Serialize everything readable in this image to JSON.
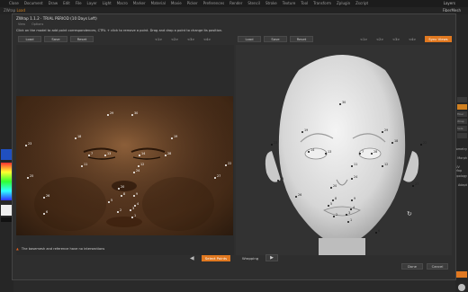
{
  "background": {
    "menu_items": [
      "Close",
      "Document",
      "Draw",
      "Edit",
      "File",
      "Layer",
      "Light",
      "Macro",
      "Marker",
      "Material",
      "Movie",
      "Picker",
      "Preferences",
      "Render",
      "Stencil",
      "Stroke",
      "Texture",
      "Tool",
      "Transform",
      "Zplugin",
      "Zscript"
    ],
    "menu_right": "Layers",
    "row2_left": "ZWrap",
    "row2_accent": "Load",
    "row2_right": "FiberMesh",
    "right_tabs": [
      "",
      "",
      "Fiber",
      "Wrap",
      "Sele",
      ""
    ],
    "right_labels": [
      "Geometry",
      "Morph",
      "UV Map",
      "Topology",
      "Adapt"
    ]
  },
  "dialog": {
    "title": "ZWrap 1.1.2 · TRIAL PERIOD (10 Days Left)",
    "menu": [
      "View",
      "Options"
    ],
    "instructions": "Click on the model to add point correspondences, CTRL + click to remove a point. Drag and drop a point to change its position.",
    "left_toolbar": {
      "load": "Load",
      "save": "Save",
      "reset": "Reset"
    },
    "right_toolbar": {
      "load": "Load",
      "save": "Save",
      "reset": "Reset"
    },
    "nav_labels": [
      "<1>",
      "<2>",
      "<3>",
      "<4>"
    ],
    "sync_views": "Sync Views",
    "warning": "The basemesh and reference have no intersections",
    "steps": {
      "select_points": "Select Points",
      "wrapping": "Wrapping"
    },
    "done": "Done",
    "cancel": "Cancel",
    "colors": {
      "accent": "#e07820",
      "panel": "#2e2e2e",
      "warning": "#e06020"
    }
  },
  "left_points": [
    {
      "id": "30",
      "label": "30"
    },
    {
      "id": "29",
      "label": "29"
    },
    {
      "id": "19",
      "label": "19"
    },
    {
      "id": "18",
      "label": "18"
    },
    {
      "id": "23",
      "label": "23"
    },
    {
      "id": "7",
      "label": "7"
    },
    {
      "id": "13",
      "label": "13"
    },
    {
      "id": "14",
      "label": "14"
    },
    {
      "id": "28",
      "label": "28"
    },
    {
      "id": "11",
      "label": "11"
    },
    {
      "id": "12",
      "label": "12"
    },
    {
      "id": "22",
      "label": "22"
    },
    {
      "id": "25",
      "label": "25"
    },
    {
      "id": "26",
      "label": "26"
    },
    {
      "id": "24",
      "label": "24"
    },
    {
      "id": "27",
      "label": "27"
    },
    {
      "id": "20",
      "label": "20"
    },
    {
      "id": "8",
      "label": "8"
    },
    {
      "id": "9",
      "label": "9"
    },
    {
      "id": "5",
      "label": "5"
    },
    {
      "id": "4",
      "label": "4"
    },
    {
      "id": "3",
      "label": "3"
    },
    {
      "id": "2",
      "label": "2"
    },
    {
      "id": "1",
      "label": "1"
    },
    {
      "id": "6",
      "label": "6"
    }
  ],
  "right_points": [
    {
      "id": "30",
      "label": "30"
    },
    {
      "id": "19",
      "label": "19"
    },
    {
      "id": "29",
      "label": "29"
    },
    {
      "id": "18",
      "label": "18"
    },
    {
      "id": "23",
      "label": "23"
    },
    {
      "id": "14",
      "label": "14"
    },
    {
      "id": "13",
      "label": "13"
    },
    {
      "id": "7",
      "label": "7"
    },
    {
      "id": "28",
      "label": "28"
    },
    {
      "id": "11",
      "label": "11"
    },
    {
      "id": "12",
      "label": "12"
    },
    {
      "id": "22",
      "label": "22"
    },
    {
      "id": "25",
      "label": "25"
    },
    {
      "id": "26",
      "label": "26"
    },
    {
      "id": "24",
      "label": "24"
    },
    {
      "id": "27",
      "label": "27"
    },
    {
      "id": "20",
      "label": "20"
    },
    {
      "id": "8",
      "label": "8"
    },
    {
      "id": "9",
      "label": "9"
    },
    {
      "id": "5",
      "label": "5"
    },
    {
      "id": "4",
      "label": "4"
    },
    {
      "id": "3",
      "label": "3"
    },
    {
      "id": "2",
      "label": "2"
    },
    {
      "id": "1",
      "label": "1"
    },
    {
      "id": "6",
      "label": "6"
    }
  ]
}
